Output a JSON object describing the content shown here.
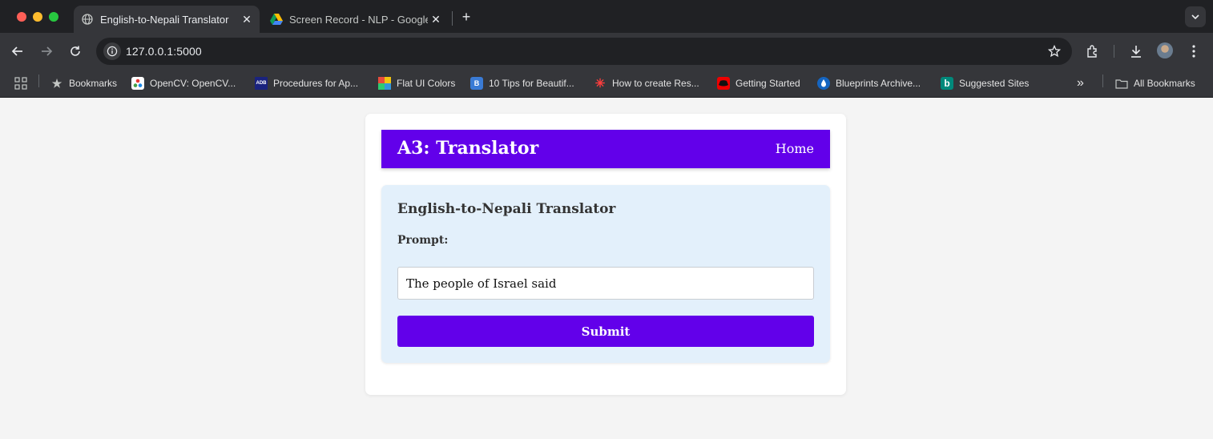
{
  "browser": {
    "tabs": [
      {
        "title": "English-to-Nepali Translator",
        "active": true,
        "icon": "globe-icon"
      },
      {
        "title": "Screen Record - NLP - Google Drive",
        "active": false,
        "icon": "google-drive-icon"
      }
    ],
    "address": {
      "url": "127.0.0.1:5000"
    },
    "bookmarks": [
      {
        "label": "Bookmarks",
        "icon": "star-icon"
      },
      {
        "label": "OpenCV: OpenCV...",
        "icon": "opencv-icon"
      },
      {
        "label": "Procedures for Ap...",
        "icon": "adb-icon",
        "icon_text": "ADB"
      },
      {
        "label": "Flat UI Colors",
        "icon": "flat-ui-colors-icon"
      },
      {
        "label": "10 Tips for Beautif...",
        "icon": "tips-icon"
      },
      {
        "label": "How to create Res...",
        "icon": "asterisk-icon"
      },
      {
        "label": "Getting Started",
        "icon": "redhat-icon"
      },
      {
        "label": "Blueprints Archive...",
        "icon": "blueprints-icon"
      },
      {
        "label": "Suggested Sites",
        "icon": "bing-icon",
        "icon_text": "b"
      }
    ],
    "all_bookmarks": "All Bookmarks"
  },
  "app": {
    "brand": "A3: Translator",
    "nav_home": "Home",
    "panel_title": "English-to-Nepali Translator",
    "prompt_label": "Prompt:",
    "prompt_value": "The people of Israel said",
    "submit_label": "Submit"
  },
  "colors": {
    "primary": "#6200ea",
    "panel_bg": "#e3f0fb",
    "page_bg": "#f4f4f4"
  }
}
